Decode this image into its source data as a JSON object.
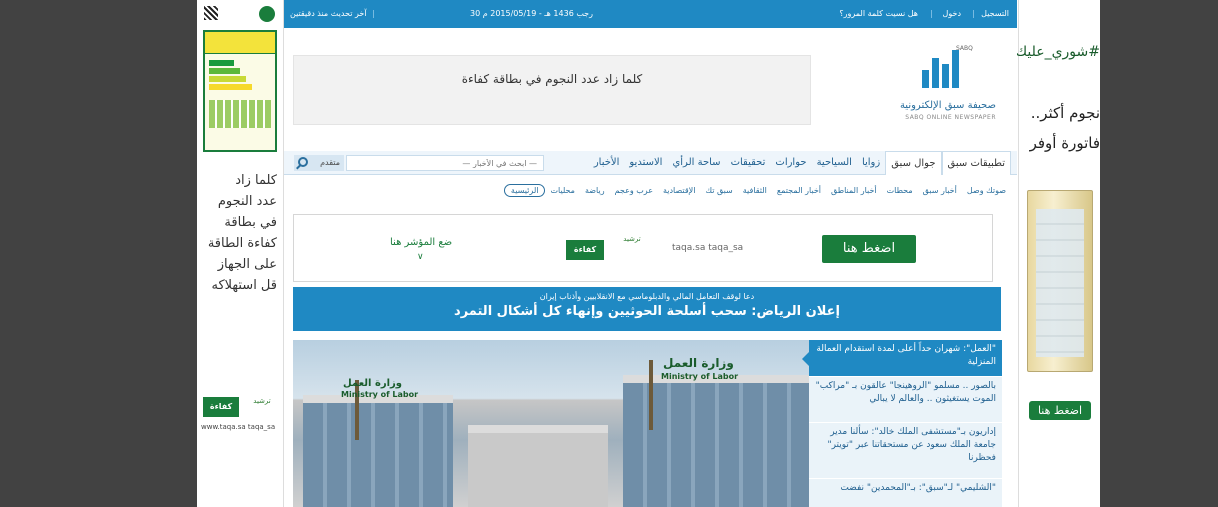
{
  "topbar": {
    "register": "التسجيل",
    "login": "دخول",
    "forgot_password": "هل نسيت كلمة المرور؟",
    "date": "30 رجب 1436 هـ - 2015/05/19 م",
    "last_update": "آخر تحديث منذ دقيقتين"
  },
  "banner": {
    "text": "كلما زاد عدد النجوم في بطاقة كفاءة"
  },
  "logo": {
    "name": "صحيفة سبق الإلكترونية",
    "english": "SABQ ONLINE NEWSPAPER",
    "short": "SABQ"
  },
  "nav": {
    "items": [
      "الأخبار",
      "الاستديو",
      "ساحة الرأي",
      "تحقيقات",
      "حوارات",
      "السياحية",
      "زوايا",
      "جوال سبق",
      "تطبيقات سبق"
    ],
    "search_placeholder": "— ابحث في الأخبار —",
    "advanced": "متقدم"
  },
  "subnav": {
    "items": [
      "الرئيسية",
      "محليات",
      "رياضة",
      "عرب وعجم",
      "الإقتصادية",
      "سبق تك",
      "الثقافية",
      "أخبار المجتمع",
      "أخبار المناطق",
      "محطات",
      "أخبار سبق",
      "صوتك وصل"
    ]
  },
  "ad": {
    "button": "اضغط هنا",
    "social": "taqa.sa  taqa_sa",
    "tarsheed": "ترشيد",
    "kafaa": "كفاءة",
    "cta": "ضع المؤشر هنا",
    "chevron": "∨"
  },
  "headline": {
    "kicker": "دعا لوقف التعامل المالي والدبلوماسي مع الانقلابيين وأذناب إيران",
    "title": "إعلان الرياض: سحب أسلحة الحوثيين وإنهاء كل أشكال التمرد"
  },
  "photo": {
    "sign_ar_1": "وزارة العمل",
    "sign_en_1": "Ministry of Labor",
    "sign_ar_2": "وزارة العمل",
    "sign_en_2": "Ministry of Labor"
  },
  "news": [
    "\"العمل\": شهران حداً أعلى لمدة استقدام العمالة المنزلية",
    "بالصور .. مسلمو \"الروهينجا\" عالقون بـ \"مراكب\" الموت يستغيثون .. والعالم لا يبالي",
    "إداريون بـ\"مستشفى الملك خالد\": سألنا مدير جامعة الملك سعود عن مستحقاتنا عبر \"تويتر\" فحظرنا",
    "\"الشليمي\" لـ\"سبق\": بـ\"المحمدين\" نفضت"
  ],
  "skin_left": {
    "lines": [
      "كلما زاد",
      "عدد النجوم",
      "في بطاقة",
      "كفاءة الطاقة",
      "على الجهاز",
      "قل استهلاكه"
    ],
    "kafaa": "كفاءة",
    "tarsheed": "ترشيد",
    "social": "www.taqa.sa  taqa_sa"
  },
  "skin_right": {
    "hashtag": "#شوري_عليك",
    "line2": "نجوم أكثر..",
    "line3": "فاتورة أوفر",
    "button": "اضغط هنا"
  }
}
